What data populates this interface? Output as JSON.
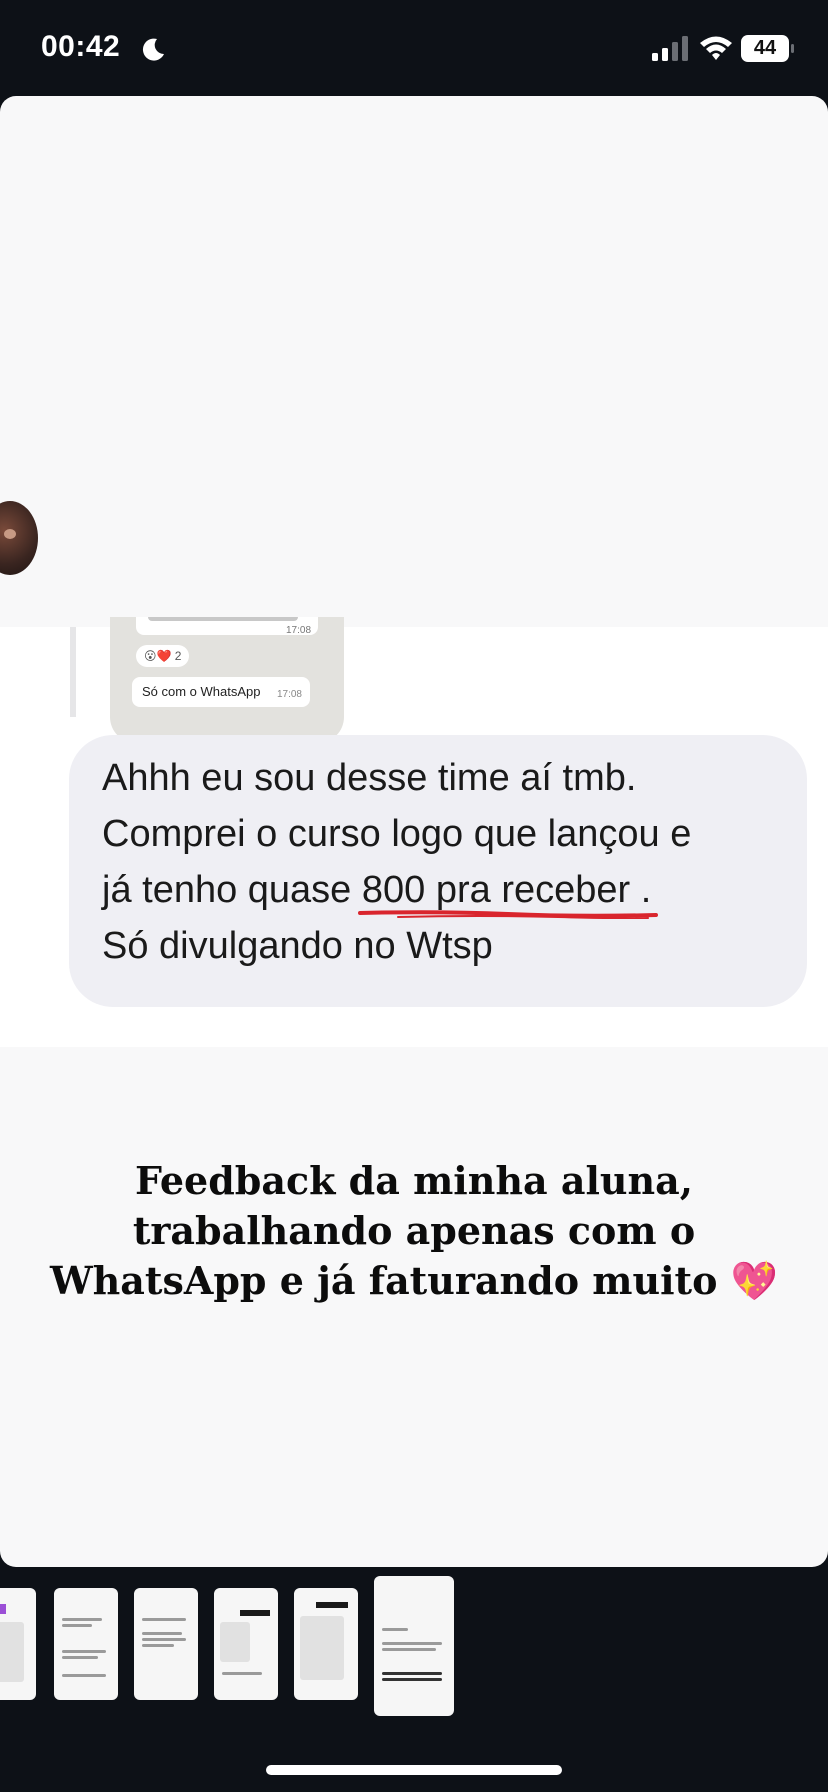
{
  "status_bar": {
    "time": "00:42",
    "battery_level": "44",
    "icons": [
      "moon-icon",
      "signal-icon",
      "wifi-icon",
      "battery-icon"
    ]
  },
  "story": {
    "quoted": {
      "time_partial": "17:08",
      "reaction_count": "2",
      "reaction_emojis": "😮❤️",
      "message": "Só com o WhatsApp",
      "message_time": "17:08"
    },
    "message": {
      "line1": "Ahhh eu sou desse time aí tmb.",
      "line2": "Comprei o curso logo que lançou e",
      "line3_prefix": "já tenho quase ",
      "line3_highlight": "800 pra receber",
      "line3_suffix": " .",
      "line4": "Só divulgando no Wtsp"
    },
    "caption": {
      "line1": "Feedback da minha aluna,",
      "line2": "trabalhando apenas com o",
      "line3": "WhatsApp e já faturando muito",
      "emoji": "💖"
    }
  },
  "thumbnails": {
    "count": 6,
    "active_index": 5
  },
  "colors": {
    "background": "#0d1117",
    "card": "#f8f8f9",
    "bubble": "#efeff4",
    "underline": "#d9252d",
    "accent_purple": "#9b4fd6"
  }
}
